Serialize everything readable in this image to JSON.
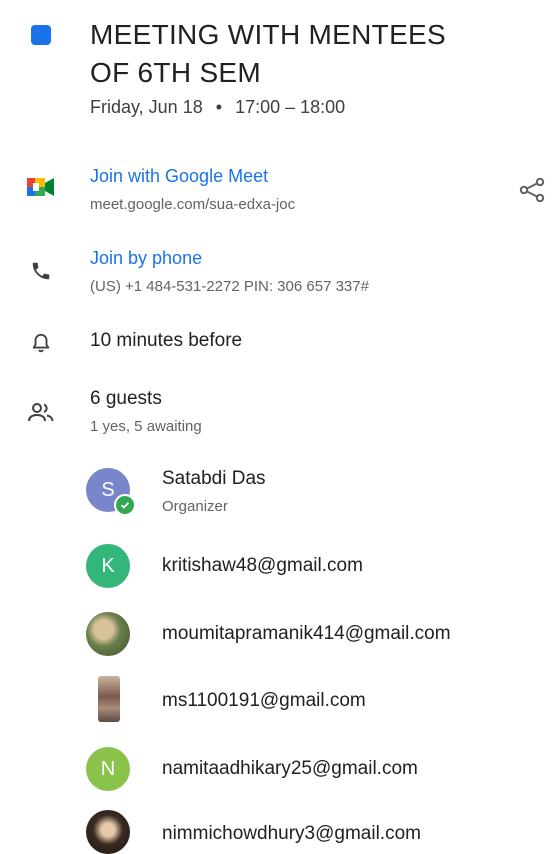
{
  "event": {
    "title_line1": "MEETING WITH MENTEES",
    "title_line2": "OF 6TH SEM",
    "color": "#1a73e8",
    "date": "Friday, Jun 18",
    "separator": "•",
    "time": "17:00 – 18:00"
  },
  "meet": {
    "label": "Join with Google Meet",
    "url": "meet.google.com/sua-edxa-joc",
    "icon": "google-meet-icon",
    "share_icon": "share-icon"
  },
  "phone": {
    "label": "Join by phone",
    "details": "(US) +1 484-531-2272 PIN: 306 657 337#",
    "icon": "phone-icon"
  },
  "reminder": {
    "text": "10 minutes before",
    "icon": "bell-icon"
  },
  "guests": {
    "count": "6 guests",
    "summary": "1 yes, 5 awaiting",
    "icon": "people-icon",
    "list": [
      {
        "name": "Satabdi Das",
        "role": "Organizer",
        "initial": "S",
        "avatar_color": "#7986cb",
        "badge": "check-icon"
      },
      {
        "name": "kritishaw48@gmail.com",
        "initial": "K",
        "avatar_color": "#33b679"
      },
      {
        "name": "moumitapramanik414@gmail.com",
        "avatar": "photo"
      },
      {
        "name": "ms1100191@gmail.com",
        "avatar": "photo"
      },
      {
        "name": "namitaadhikary25@gmail.com",
        "initial": "N",
        "avatar_color": "#8bc34a"
      },
      {
        "name": "nimmichowdhury3@gmail.com",
        "avatar": "photo"
      }
    ]
  }
}
